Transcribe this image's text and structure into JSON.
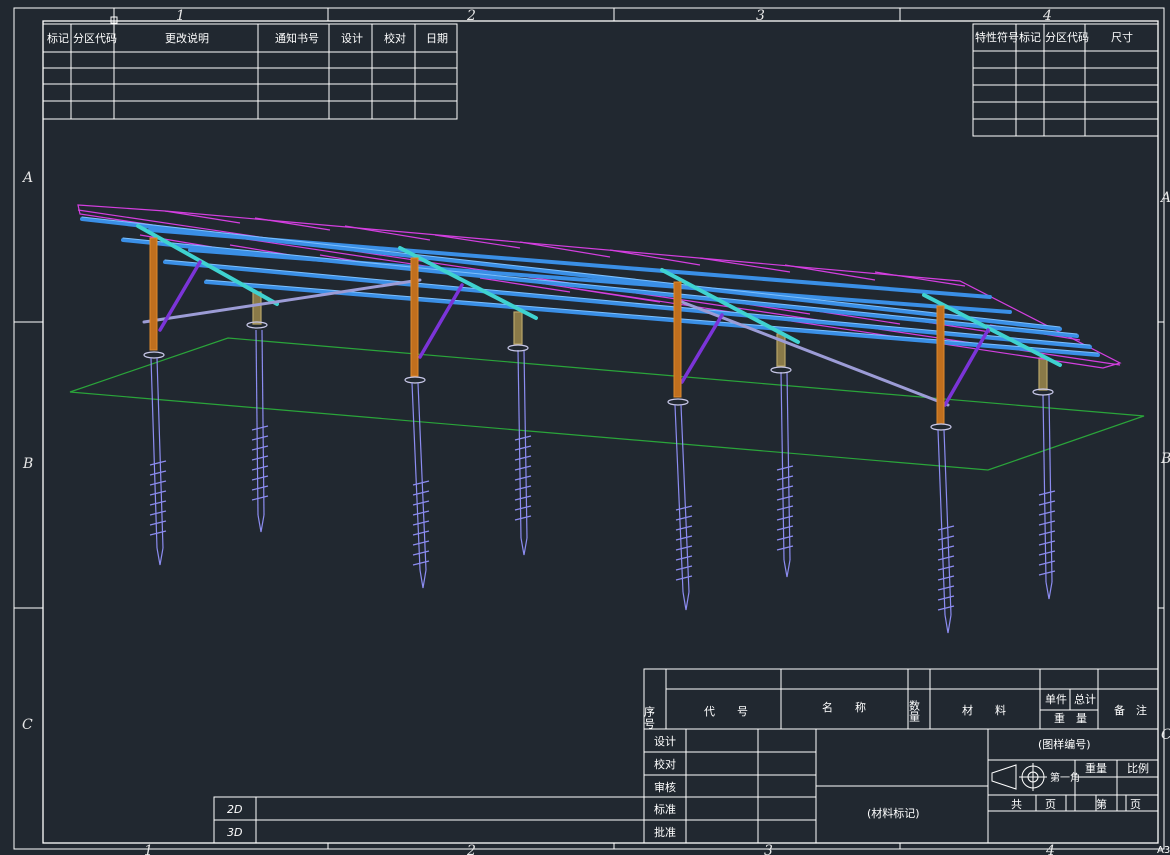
{
  "zones": {
    "columns": [
      "1",
      "2",
      "3",
      "4"
    ],
    "rows": [
      "A",
      "B",
      "C"
    ],
    "sheet_size": "A3"
  },
  "revision_table": {
    "headers": [
      "标记",
      "分区代码",
      "更改说明",
      "通知书号",
      "设计",
      "校对",
      "日期"
    ]
  },
  "feature_table": {
    "headers": [
      "特性符号",
      "标记",
      "分区代码",
      "尺寸"
    ]
  },
  "bom_header": {
    "index": "序号",
    "code": "代　　号",
    "name": "名　　称",
    "qty": "数量",
    "material": "材　　料",
    "unit": "单件",
    "total": "总计",
    "weight": "重　量",
    "remark": "备　注"
  },
  "title_block": {
    "design": "设计",
    "check": "校对",
    "review": "审核",
    "standard": "标准",
    "approve": "批准",
    "material_mark": "(材料标记)",
    "drawing_no": "(图样编号)",
    "projection": "第一角",
    "weight": "重量",
    "scale": "比例",
    "total_sheets": "共",
    "sheet_unit": "页",
    "sheet_no": "第",
    "sheet_unit2": "页"
  },
  "view_labels": {
    "two_d": "2D",
    "three_d": "3D"
  },
  "colors": {
    "background": "#212830",
    "frame": "#ffffff",
    "rail": "#3a8fe6",
    "cross_beam": "#3fd2d0",
    "panel_outline": "#d43fe0",
    "ground_plane": "#2aa53a",
    "post": "#e08a2c",
    "post_short": "#b8a66a",
    "brace": "#7b34d8",
    "screw_pile": "#8c8cf0",
    "tie_bar": "#9c9cd6"
  }
}
